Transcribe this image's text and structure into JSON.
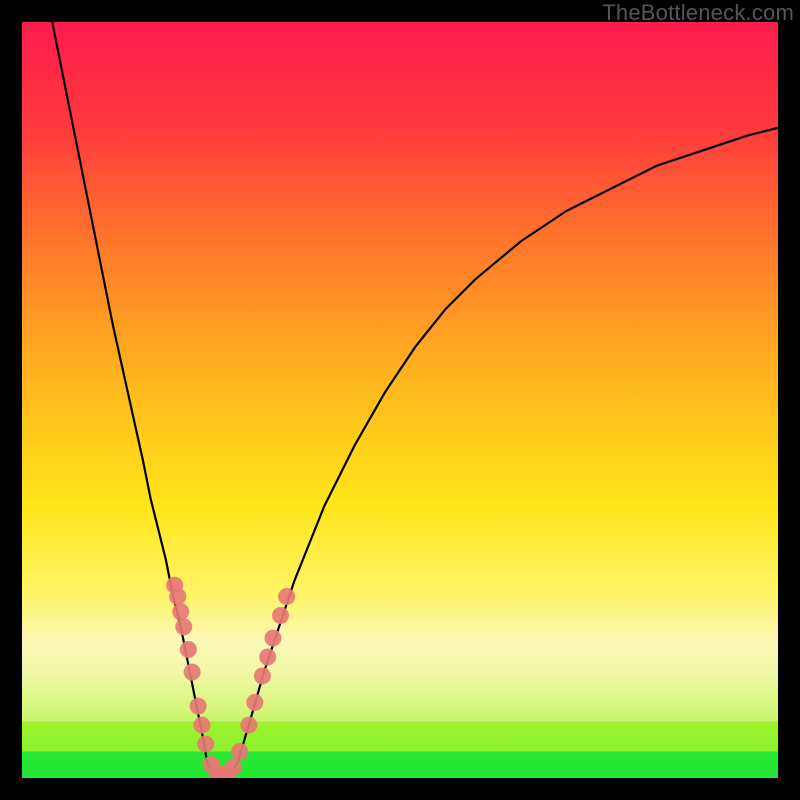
{
  "watermark": "TheBottleneck.com",
  "colors": {
    "curve_stroke": "#000000",
    "marker_fill": "#e77874",
    "green_band": "#27e833",
    "lime_band": "#9ff22f",
    "pale_band": "#f2f8a8"
  },
  "chart_data": {
    "type": "line",
    "title": "",
    "xlabel": "",
    "ylabel": "",
    "xlim": [
      0,
      100
    ],
    "ylim": [
      0,
      100
    ],
    "curves": [
      {
        "name": "left_branch",
        "x": [
          4,
          6,
          8,
          10,
          12,
          14,
          16,
          17,
          18,
          19,
          20,
          21,
          22,
          23,
          24,
          24.5
        ],
        "y": [
          100,
          90,
          80,
          70,
          60,
          51,
          42,
          37,
          33,
          29,
          24,
          20,
          15,
          10,
          5,
          2
        ]
      },
      {
        "name": "valley",
        "x": [
          24.5,
          25.5,
          26.5,
          27.5,
          28.5
        ],
        "y": [
          2,
          0.5,
          0.3,
          0.5,
          2
        ]
      },
      {
        "name": "right_branch",
        "x": [
          28.5,
          30,
          32,
          34,
          36,
          38,
          40,
          44,
          48,
          52,
          56,
          60,
          66,
          72,
          78,
          84,
          90,
          96,
          100
        ],
        "y": [
          2,
          7,
          14,
          20,
          26,
          31,
          36,
          44,
          51,
          57,
          62,
          66,
          71,
          75,
          78,
          81,
          83,
          85,
          86
        ]
      }
    ],
    "markers": [
      {
        "x": 20.2,
        "y": 25.5
      },
      {
        "x": 20.6,
        "y": 24.0
      },
      {
        "x": 21.0,
        "y": 22.0
      },
      {
        "x": 21.4,
        "y": 20.0
      },
      {
        "x": 22.0,
        "y": 17.0
      },
      {
        "x": 22.5,
        "y": 14.0
      },
      {
        "x": 23.3,
        "y": 9.5
      },
      {
        "x": 23.8,
        "y": 7.0
      },
      {
        "x": 24.3,
        "y": 4.5
      },
      {
        "x": 25.0,
        "y": 1.8
      },
      {
        "x": 25.8,
        "y": 0.7
      },
      {
        "x": 26.5,
        "y": 0.4
      },
      {
        "x": 27.2,
        "y": 0.6
      },
      {
        "x": 28.0,
        "y": 1.5
      },
      {
        "x": 28.8,
        "y": 3.5
      },
      {
        "x": 30.0,
        "y": 7.0
      },
      {
        "x": 30.8,
        "y": 10.0
      },
      {
        "x": 31.8,
        "y": 13.5
      },
      {
        "x": 32.5,
        "y": 16.0
      },
      {
        "x": 33.2,
        "y": 18.5
      },
      {
        "x": 34.2,
        "y": 21.5
      },
      {
        "x": 35.0,
        "y": 24.0
      }
    ],
    "gradient_stops": [
      {
        "offset": 0.0,
        "color": "#ff1a4e"
      },
      {
        "offset": 0.14,
        "color": "#ff3a3d"
      },
      {
        "offset": 0.3,
        "color": "#ff7a2a"
      },
      {
        "offset": 0.48,
        "color": "#ffb81e"
      },
      {
        "offset": 0.64,
        "color": "#ffe61a"
      },
      {
        "offset": 0.76,
        "color": "#fff56a"
      },
      {
        "offset": 0.82,
        "color": "#fbf8b8"
      },
      {
        "offset": 0.86,
        "color": "#f2f8a8"
      },
      {
        "offset": 0.92,
        "color": "#9ff22f"
      },
      {
        "offset": 0.97,
        "color": "#27e833"
      },
      {
        "offset": 1.0,
        "color": "#1fe540"
      }
    ]
  }
}
